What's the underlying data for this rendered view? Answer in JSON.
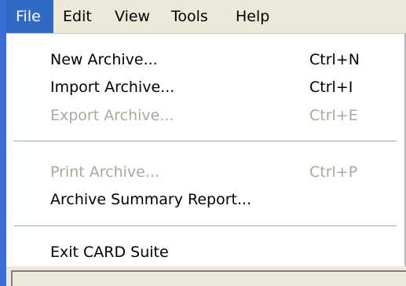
{
  "menubar": {
    "items": [
      {
        "label": "File",
        "active": true
      },
      {
        "label": "Edit"
      },
      {
        "label": "View"
      },
      {
        "label": "Tools"
      },
      {
        "label": "Help"
      }
    ]
  },
  "file_menu": {
    "items": [
      {
        "label": "New Archive...",
        "shortcut": "Ctrl+N",
        "enabled": true
      },
      {
        "label": "Import Archive...",
        "shortcut": "Ctrl+I",
        "enabled": true
      },
      {
        "label": "Export Archive...",
        "shortcut": "Ctrl+E",
        "enabled": false
      },
      {
        "label": "Print Archive...",
        "shortcut": "Ctrl+P",
        "enabled": false
      },
      {
        "label": "Archive Summary Report...",
        "shortcut": "",
        "enabled": true
      },
      {
        "label": "Exit CARD Suite",
        "shortcut": "",
        "enabled": true
      }
    ]
  },
  "colors": {
    "highlight": "#316ac5",
    "disabled_text": "#aca899",
    "window_edge": "#3a6fd8"
  }
}
